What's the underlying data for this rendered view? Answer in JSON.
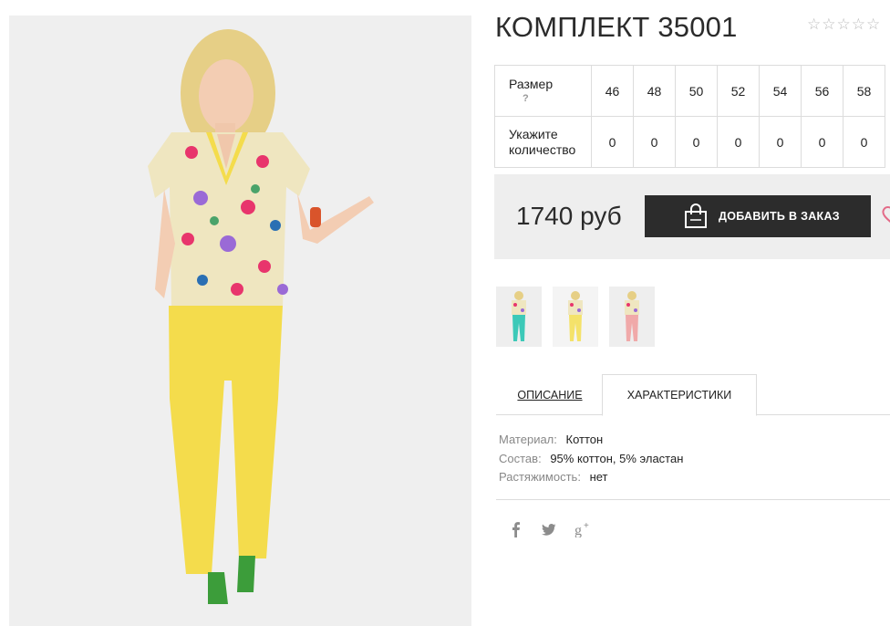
{
  "product": {
    "title": "КОМПЛЕКТ 35001",
    "rating": {
      "value": 0,
      "max": 5,
      "star_glyph": "☆"
    },
    "price": "1740 руб",
    "add_to_order_label": "ДОБАВИТЬ В ЗАКАЗ",
    "wishlist_icon": "heart-icon"
  },
  "size_table": {
    "size_row_label": "Размер",
    "help_mark": "?",
    "qty_row_label": "Укажите количество",
    "sizes": [
      "46",
      "48",
      "50",
      "52",
      "54",
      "56",
      "58"
    ],
    "quantities": [
      "0",
      "0",
      "0",
      "0",
      "0",
      "0",
      "0"
    ]
  },
  "thumbnails": [
    {
      "name": "thumb-turquoise",
      "pants_color": "#3cc9b8"
    },
    {
      "name": "thumb-yellow",
      "pants_color": "#f4e26a"
    },
    {
      "name": "thumb-pink",
      "pants_color": "#f0a9a9"
    }
  ],
  "tabs": [
    {
      "label": "ОПИСАНИЕ",
      "active": false
    },
    {
      "label": "ХАРАКТЕРИСТИКИ",
      "active": true
    }
  ],
  "specs": [
    {
      "label": "Материал:",
      "value": "Коттон"
    },
    {
      "label": "Состав:",
      "value": "95% коттон, 5% эластан"
    },
    {
      "label": "Растяжимость:",
      "value": "нет"
    }
  ],
  "social": [
    "facebook-icon",
    "twitter-icon",
    "google-plus-icon"
  ],
  "colors": {
    "button_bg": "#2c2c2c",
    "buy_box_bg": "#eeeeee",
    "heart": "#e36b88",
    "pants": "#f4dc4c",
    "blouse": "#efe6c0"
  }
}
